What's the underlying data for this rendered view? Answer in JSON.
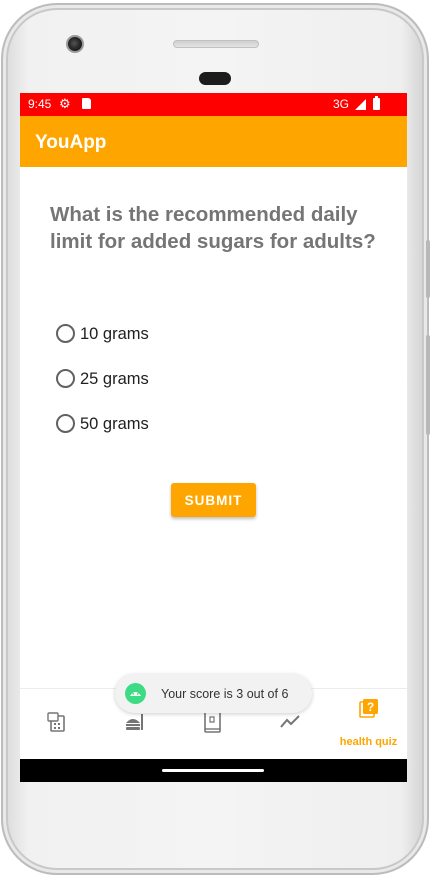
{
  "status_bar": {
    "time": "9:45",
    "network": "3G",
    "gear_glyph": "⚙"
  },
  "app_bar": {
    "title": "YouApp"
  },
  "quiz": {
    "question": "What is the recommended daily limit for added sugars for adults?",
    "options": [
      {
        "label": "10 grams",
        "selected": false
      },
      {
        "label": "25 grams",
        "selected": false
      },
      {
        "label": "50 grams",
        "selected": false
      }
    ],
    "submit_label": "SUBMIT"
  },
  "toast": {
    "message": "Your score is 3 out of 6",
    "icon": "android-icon"
  },
  "bottom_nav": {
    "items": [
      {
        "icon": "calculator-icon",
        "label": ""
      },
      {
        "icon": "food-icon",
        "label": ""
      },
      {
        "icon": "recipe-book-icon",
        "label": ""
      },
      {
        "icon": "trending-icon",
        "label": ""
      },
      {
        "icon": "quiz-icon",
        "label": "health quiz",
        "active": true
      }
    ]
  },
  "colors": {
    "status_bar": "#ff0000",
    "app_bar": "#ffa500",
    "accent": "#ffa500",
    "question_text": "#757575",
    "inactive_icon": "#757575"
  }
}
